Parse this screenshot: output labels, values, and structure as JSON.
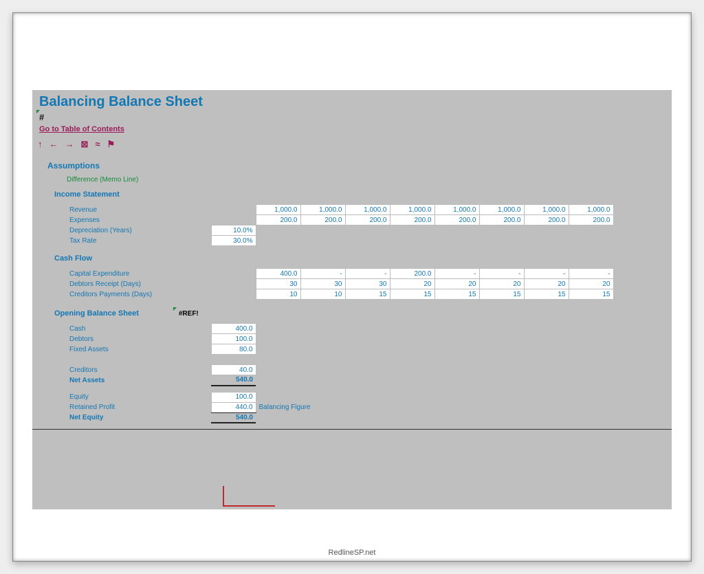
{
  "title": "Balancing Balance Sheet",
  "hash": "#",
  "toc": "Go to Table of Contents",
  "toolbar": {
    "up": "↑",
    "back": "←",
    "fwd": "→",
    "chk": "⊠",
    "wave": "≈",
    "flag": "⚑"
  },
  "sections": {
    "assumptions": "Assumptions",
    "memo": "Difference (Memo Line)",
    "income": "Income Statement",
    "cashflow": "Cash Flow",
    "opening": "Opening Balance Sheet",
    "ref": "#REF!"
  },
  "income_rows": {
    "revenue": {
      "label": "Revenue",
      "v": [
        "1,000.0",
        "1,000.0",
        "1,000.0",
        "1,000.0",
        "1,000.0",
        "1,000.0",
        "1,000.0",
        "1,000.0"
      ]
    },
    "expenses": {
      "label": "Expenses",
      "v": [
        "200.0",
        "200.0",
        "200.0",
        "200.0",
        "200.0",
        "200.0",
        "200.0",
        "200.0"
      ]
    },
    "dep": {
      "label": "Depreciation (Years)",
      "pct": "10.0%"
    },
    "tax": {
      "label": "Tax Rate",
      "pct": "30.0%"
    }
  },
  "cashflow_rows": {
    "capex": {
      "label": "Capital Expenditure",
      "v": [
        "400.0",
        "-",
        "-",
        "200.0",
        "-",
        "-",
        "-",
        "-"
      ]
    },
    "debtors": {
      "label": "Debtors Receipt (Days)",
      "v": [
        "30",
        "30",
        "30",
        "20",
        "20",
        "20",
        "20",
        "20"
      ]
    },
    "creditors": {
      "label": "Creditors Payments (Days)",
      "v": [
        "10",
        "10",
        "15",
        "15",
        "15",
        "15",
        "15",
        "15"
      ]
    }
  },
  "balance": {
    "cash": {
      "label": "Cash",
      "v": "400.0"
    },
    "debtors": {
      "label": "Debtors",
      "v": "100.0"
    },
    "fixed": {
      "label": "Fixed Assets",
      "v": "80.0"
    },
    "creditors": {
      "label": "Creditors",
      "v": "40.0"
    },
    "netassets": {
      "label": "Net Assets",
      "v": "540.0"
    },
    "equity": {
      "label": "Equity",
      "v": "100.0"
    },
    "retained": {
      "label": "Retained Profit",
      "v": "440.0",
      "note": "Balancing Figure"
    },
    "netequity": {
      "label": "Net Equity",
      "v": "540.0"
    }
  },
  "footer": "RedlineSP.net"
}
